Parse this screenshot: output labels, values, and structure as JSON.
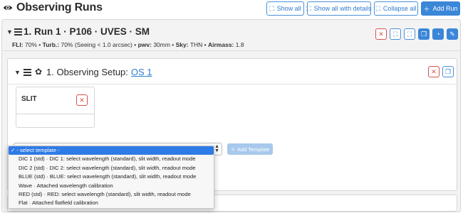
{
  "header": {
    "title": "Observing Runs",
    "eye_icon": "eye-icon",
    "buttons": {
      "show_all": "Show all",
      "show_all_details": "Show all with details",
      "collapse_all": "Collapse all",
      "add_run": "Add Run"
    }
  },
  "run": {
    "title": "1. Run 1 · P106 · UVES · SM",
    "conditions": [
      {
        "label": "FLI:",
        "value": " 70% • "
      },
      {
        "label": "Turb.:",
        "value": " 70% (Seeing < 1.0 arcsec) • "
      },
      {
        "label": "pwv:",
        "value": " 30mm • "
      },
      {
        "label": "Sky:",
        "value": " THN • "
      },
      {
        "label": "Airmass:",
        "value": " 1.8"
      }
    ],
    "action_icons": [
      "close-icon",
      "compress-icon",
      "expand-icon",
      "copy-icon",
      "clock-icon",
      "edit-icon"
    ]
  },
  "setup": {
    "title": "1. Observing Setup:",
    "link": "OS 1"
  },
  "slit_card": {
    "label": "SLIT"
  },
  "template_select": {
    "add_label": "Add Template",
    "options": [
      "- select template -",
      "DIC 1 (std)  ·  DIC 1: select wavelength (standard), slit width, readout mode",
      "DIC 2 (std)  ·  DIC 2: select wavelength (standard), slit width, readout mode",
      "BLUE (std)  ·  BLUE: select wavelength (standard), slit width, readout mode",
      "Wave  ·  Attached wavelength calibration",
      "RED (std)  ·  RED: select wavelength (standard), slit width, readout mode",
      "Flat  ·  Attached flatfield calibration"
    ],
    "selected_index": 0
  },
  "colors": {
    "accent": "#3a86d8",
    "danger": "#d9534f",
    "panel_bg": "#f3f3f3",
    "dropdown_highlight": "#2f7be6"
  }
}
